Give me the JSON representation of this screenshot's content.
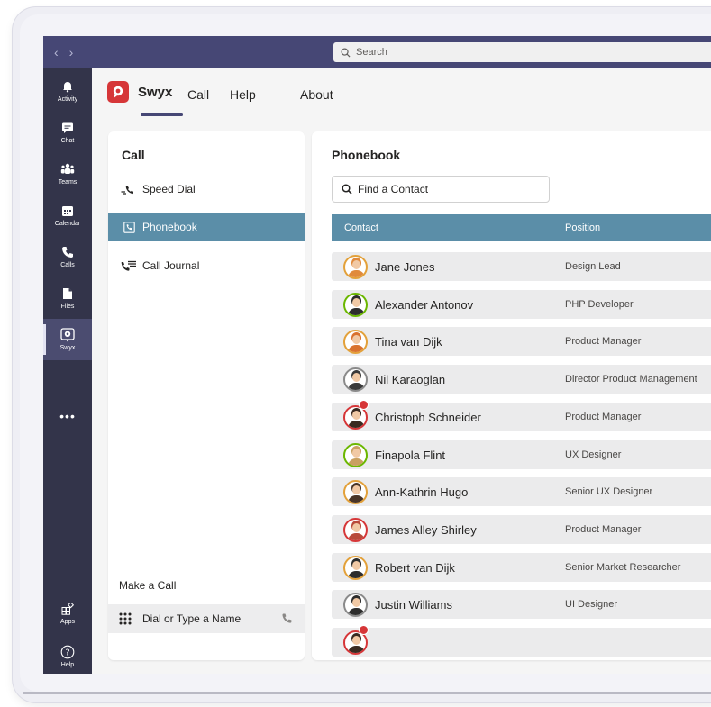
{
  "titlebar": {
    "search_placeholder": "Search"
  },
  "rail": {
    "items": [
      {
        "label": "Activity",
        "icon": "bell-icon"
      },
      {
        "label": "Chat",
        "icon": "chat-icon"
      },
      {
        "label": "Teams",
        "icon": "teams-icon"
      },
      {
        "label": "Calendar",
        "icon": "calendar-icon"
      },
      {
        "label": "Calls",
        "icon": "phone-icon"
      },
      {
        "label": "Files",
        "icon": "file-icon"
      },
      {
        "label": "Swyx",
        "icon": "swyx-icon"
      }
    ],
    "more": "•••",
    "apps_label": "Apps",
    "help_label": "Help"
  },
  "app": {
    "name": "Swyx",
    "tabs": [
      "Call",
      "Help",
      "About"
    ],
    "active_tab": "Call"
  },
  "left_panel": {
    "title": "Call",
    "items": [
      {
        "label": "Speed Dial",
        "icon": "speed-dial-icon"
      },
      {
        "label": "Phonebook",
        "icon": "phonebook-icon"
      },
      {
        "label": "Call Journal",
        "icon": "call-journal-icon"
      }
    ],
    "active_item": "Phonebook",
    "make_call_label": "Make a Call",
    "dial_placeholder": "Dial or Type a Name"
  },
  "phonebook": {
    "title": "Phonebook",
    "find_placeholder": "Find a Contact",
    "columns": [
      "Contact",
      "Position"
    ],
    "contacts": [
      {
        "name": "Jane Jones",
        "position": "Design Lead",
        "status": "#e3a13a",
        "hair": "#e08a3c",
        "badge": false
      },
      {
        "name": "Alexander Antonov",
        "position": "PHP Developer",
        "status": "#6bb700",
        "hair": "#2d2d2d",
        "badge": false
      },
      {
        "name": "Tina van Dijk",
        "position": "Product Manager",
        "status": "#e3a13a",
        "hair": "#d9722e",
        "badge": false
      },
      {
        "name": "Nil Karaoglan",
        "position": "Director Product Management",
        "status": "#8a8a8a",
        "hair": "#3a3a3a",
        "badge": false
      },
      {
        "name": "Christoph Schneider",
        "position": "Product Manager",
        "status": "#d63638",
        "hair": "#3a2a20",
        "badge": true
      },
      {
        "name": "Finapola Flint",
        "position": "UX Designer",
        "status": "#6bb700",
        "hair": "#c9a060",
        "badge": false
      },
      {
        "name": "Ann-Kathrin Hugo",
        "position": "Senior UX Designer",
        "status": "#e3a13a",
        "hair": "#4a3526",
        "badge": false
      },
      {
        "name": "James Alley Shirley",
        "position": "Product Manager",
        "status": "#d63638",
        "hair": "#b84a3a",
        "badge": false
      },
      {
        "name": "Robert van Dijk",
        "position": "Senior Market Researcher",
        "status": "#e3a13a",
        "hair": "#2d2d2d",
        "badge": false
      },
      {
        "name": "Justin Williams",
        "position": "UI Designer",
        "status": "#8a8a8a",
        "hair": "#2d2d2d",
        "badge": false
      }
    ]
  },
  "colors": {
    "titlebar": "#464775",
    "rail": "#33344a",
    "accent": "#5b8ea8",
    "brand": "#d63638"
  }
}
